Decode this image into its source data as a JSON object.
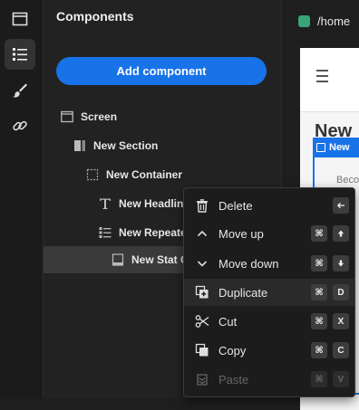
{
  "rail": {
    "items": [
      {
        "icon": "layout-window-icon"
      },
      {
        "icon": "list-icon"
      },
      {
        "icon": "brush-icon"
      },
      {
        "icon": "link-icon"
      }
    ]
  },
  "panel": {
    "title": "Components",
    "add_button": "Add component",
    "tree": [
      {
        "label": "Screen",
        "icon": "screen-icon"
      },
      {
        "label": "New Section",
        "icon": "section-icon"
      },
      {
        "label": "New Container",
        "icon": "container-icon"
      },
      {
        "label": "New Headline",
        "icon": "text-icon"
      },
      {
        "label": "New Repeater",
        "icon": "list-icon"
      },
      {
        "label": "New Stat C",
        "icon": "stat-card-icon"
      }
    ]
  },
  "canvas": {
    "url": "/home",
    "title": "New",
    "selection_label": "New",
    "text_1": "Beco"
  },
  "context_menu": {
    "items": [
      {
        "label": "Delete",
        "icon": "trash-icon",
        "keys": [
          "backspace"
        ]
      },
      {
        "label": "Move up",
        "icon": "chevron-up-icon",
        "keys": [
          "⌘",
          "arrow-up"
        ]
      },
      {
        "label": "Move down",
        "icon": "chevron-down-icon",
        "keys": [
          "⌘",
          "arrow-down"
        ]
      },
      {
        "label": "Duplicate",
        "icon": "duplicate-icon",
        "keys": [
          "⌘",
          "D"
        ]
      },
      {
        "label": "Cut",
        "icon": "scissors-icon",
        "keys": [
          "⌘",
          "X"
        ]
      },
      {
        "label": "Copy",
        "icon": "copy-icon",
        "keys": [
          "⌘",
          "C"
        ]
      },
      {
        "label": "Paste",
        "icon": "paste-icon",
        "keys": [
          "⌘",
          "V"
        ]
      }
    ]
  },
  "colors": {
    "accent": "#1973e8",
    "url_dot": "#3aa37a"
  }
}
